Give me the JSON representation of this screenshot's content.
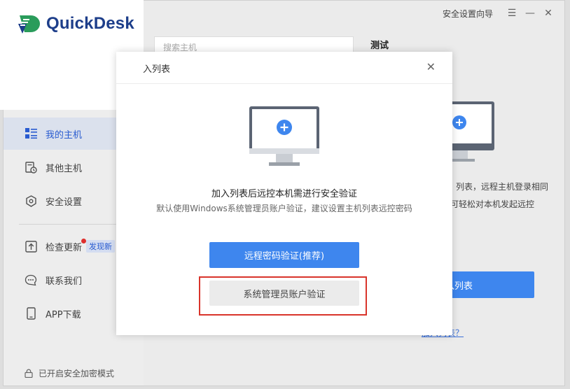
{
  "app": {
    "name": "QuickDesk"
  },
  "titlebar": {
    "security_wizard": "安全设置向导",
    "menu_glyph": "☰",
    "minimize_glyph": "—",
    "close_glyph": "✕"
  },
  "sidebar": {
    "items": [
      {
        "label": "我的主机",
        "icon": "host-list-icon",
        "active": true
      },
      {
        "label": "其他主机",
        "icon": "other-hosts-icon",
        "active": false
      },
      {
        "label": "安全设置",
        "icon": "shield-icon",
        "active": false
      },
      {
        "label": "检查更新",
        "icon": "update-icon",
        "badge": "发现新"
      },
      {
        "label": "联系我们",
        "icon": "chat-icon"
      },
      {
        "label": "APP下载",
        "icon": "phone-icon"
      }
    ],
    "footer": "已开启安全加密模式"
  },
  "main": {
    "search_placeholder": "搜索主机",
    "title": "测试",
    "desc_line1": "列表，远程主机登录相同",
    "desc_line2": "可轻松对本机发起远控",
    "add_button": "入列表",
    "help_link": "加入列表？"
  },
  "dialog": {
    "title": "入列表",
    "close_glyph": "✕",
    "message": "加入列表后远控本机需进行安全验证",
    "submessage": "默认使用Windows系统管理员账户验证，建议设置主机列表远控密码",
    "primary_button": "远程密码验证(推荐)",
    "secondary_button": "系统管理员账户验证"
  },
  "colors": {
    "accent": "#3e86ee",
    "brand": "#1d3e8a",
    "highlight": "#d9342b"
  }
}
